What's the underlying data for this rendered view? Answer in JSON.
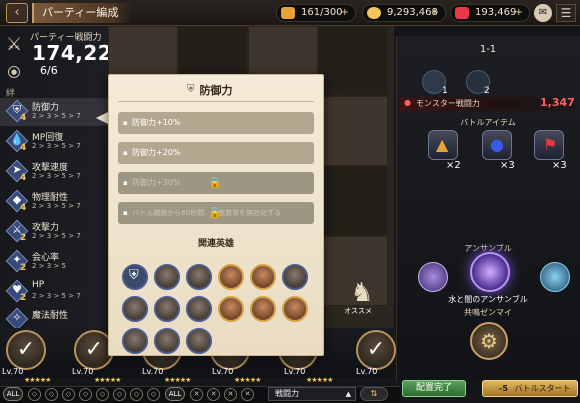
{
  "header": {
    "back_icon": "chevron-left-icon",
    "title": "パーティー編成",
    "resources": [
      {
        "icon": "stamina-icon",
        "value": "161/300",
        "color": "#e8a23a"
      },
      {
        "icon": "coin-icon",
        "value": "9,293,468",
        "color": "#f3c55a"
      },
      {
        "icon": "gem-icon",
        "value": "193,469",
        "color": "#e8384a"
      }
    ],
    "mail_icon": "mail-icon",
    "menu_icon": "menu-icon"
  },
  "party": {
    "power_label": "パーティー戦闘力",
    "power_value": "174,227",
    "slots": "6/6",
    "bond_label": "絆"
  },
  "bonds": [
    {
      "name": "防御力",
      "level": "4",
      "tiers": "2 > 3 > 5 > 7",
      "icon": "shield-icon",
      "selected": true
    },
    {
      "name": "MP回復",
      "level": "4",
      "tiers": "2 > 3 > 5 > 7",
      "icon": "droplet-icon"
    },
    {
      "name": "攻撃速度",
      "level": "4",
      "tiers": "2 > 3 > 5 > 7",
      "icon": "speed-icon"
    },
    {
      "name": "物理耐性",
      "level": "4",
      "tiers": "2 > 3 > 5 > 7",
      "icon": "armor-icon"
    },
    {
      "name": "攻撃力",
      "level": "2",
      "tiers": "2 > 3 > 5 > 7",
      "icon": "sword-icon"
    },
    {
      "name": "会心率",
      "level": "2",
      "tiers": "2 > 3 > 5",
      "icon": "crit-icon"
    },
    {
      "name": "HP",
      "level": "2",
      "tiers": "2 > 3 > 5 > 7",
      "icon": "heart-icon"
    },
    {
      "name": "魔法耐性",
      "level": "",
      "tiers": "",
      "icon": "magic-shield-icon"
    }
  ],
  "popup": {
    "title": "防御力",
    "title_icon": "shield-icon",
    "tiers": [
      {
        "text": "防御力+10%",
        "active": true
      },
      {
        "text": "防御力+20%",
        "active": true
      },
      {
        "text": "防御力+30%",
        "active": false,
        "locked": true
      },
      {
        "text": "バトル開始から60秒間、状態異常を無効化する",
        "active": false,
        "locked": true
      }
    ],
    "heroes_label": "関連英雄",
    "hero_count": 15
  },
  "roster": {
    "levels": [
      "Lv.70",
      "Lv.70",
      "Lv.70",
      "Lv.70",
      "Lv.70",
      "Lv.70",
      "Lv.70",
      "Lv.70"
    ],
    "stars": "★★★★★",
    "all_label": "ALL",
    "sort_label": "戦闘力",
    "order_icon": "sort-order-icon"
  },
  "board": {
    "recommend_label": "オススメ",
    "piece_icon": "knight-piece-icon"
  },
  "right": {
    "stage": "1-1",
    "monsters": [
      {
        "count": "1"
      },
      {
        "count": "2"
      }
    ],
    "monster_power_label": "モンスター戦闘力",
    "monster_power_value": "1,347",
    "items_label": "バトルアイテム",
    "items": [
      {
        "icon": "triangle-potion-icon",
        "count": "×2",
        "color": "#e8a23a"
      },
      {
        "icon": "bomb-icon",
        "count": "×3",
        "color": "#3a5ae8"
      },
      {
        "icon": "flag-icon",
        "count": "×3",
        "color": "#e83a3a"
      }
    ],
    "ensemble_label": "アンサンブル",
    "ensemble_name": "水と闇のアンサンブル",
    "resonance_label": "共鳴ゼンマイ",
    "ready_label": "配置完了",
    "start_cost": "-5",
    "start_label": "バトルスタート"
  }
}
